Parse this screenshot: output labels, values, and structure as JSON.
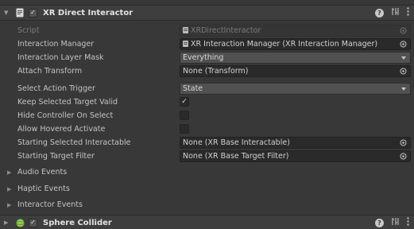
{
  "component": {
    "title": "XR Direct Interactor",
    "enabled": true,
    "icons": [
      "script-icon",
      "help-icon",
      "preset-icon",
      "kebab-menu-icon"
    ]
  },
  "fields": {
    "script": {
      "label": "Script",
      "value": "XRDirectInteractor"
    },
    "interaction_manager": {
      "label": "Interaction Manager",
      "value": "XR Interaction Manager (XR Interaction Manager)"
    },
    "interaction_layer_mask": {
      "label": "Interaction Layer Mask",
      "value": "Everything"
    },
    "attach_transform": {
      "label": "Attach Transform",
      "value": "None (Transform)"
    },
    "select_action_trigger": {
      "label": "Select Action Trigger",
      "value": "State"
    },
    "keep_selected_target_valid": {
      "label": "Keep Selected Target Valid",
      "checked": true
    },
    "hide_controller_on_select": {
      "label": "Hide Controller On Select",
      "checked": false
    },
    "allow_hovered_activate": {
      "label": "Allow Hovered Activate",
      "checked": false
    },
    "starting_selected_interactable": {
      "label": "Starting Selected Interactable",
      "value": "None (XR Base Interactable)"
    },
    "starting_target_filter": {
      "label": "Starting Target Filter",
      "value": "None (XR Base Target Filter)"
    }
  },
  "foldouts": {
    "audio": "Audio Events",
    "haptic": "Haptic Events",
    "interactor": "Interactor Events"
  },
  "next_component": {
    "title": "Sphere Collider",
    "enabled": true
  },
  "checkmark": "✓"
}
